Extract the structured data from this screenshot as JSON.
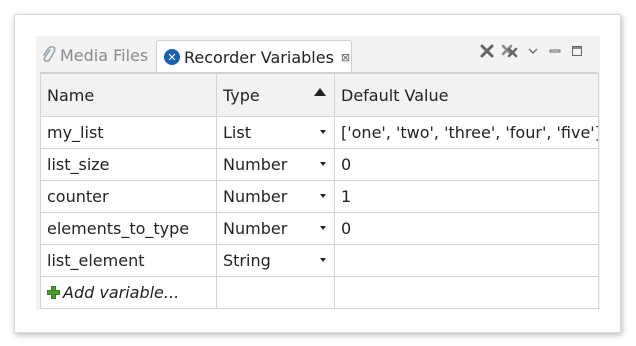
{
  "tabs": {
    "inactive": {
      "label": "Media Files",
      "icon": "paperclip-icon"
    },
    "active": {
      "label": "Recorder Variables",
      "icon": "recorder-icon",
      "close": "⊠"
    }
  },
  "view_actions": [
    "remove-all-icon",
    "remove-icon",
    "view-menu-icon",
    "minimize-icon",
    "maximize-icon"
  ],
  "table": {
    "headers": {
      "name": "Name",
      "type": "Type",
      "default": "Default Value"
    },
    "sort": {
      "column": "Type",
      "direction": "ascending"
    },
    "rows": [
      {
        "name": "my_list",
        "type": "List",
        "default": "['one', 'two', 'three', 'four', 'five']"
      },
      {
        "name": "list_size",
        "type": "Number",
        "default": "0"
      },
      {
        "name": "counter",
        "type": "Number",
        "default": "1"
      },
      {
        "name": "elements_to_type",
        "type": "Number",
        "default": "0"
      },
      {
        "name": "list_element",
        "type": "String",
        "default": ""
      }
    ],
    "add_variable": "Add variable..."
  },
  "colors": {
    "accent": "#1a5fb4",
    "add_icon": "#4a9e2a",
    "header_bg": "#f2f2f2"
  }
}
